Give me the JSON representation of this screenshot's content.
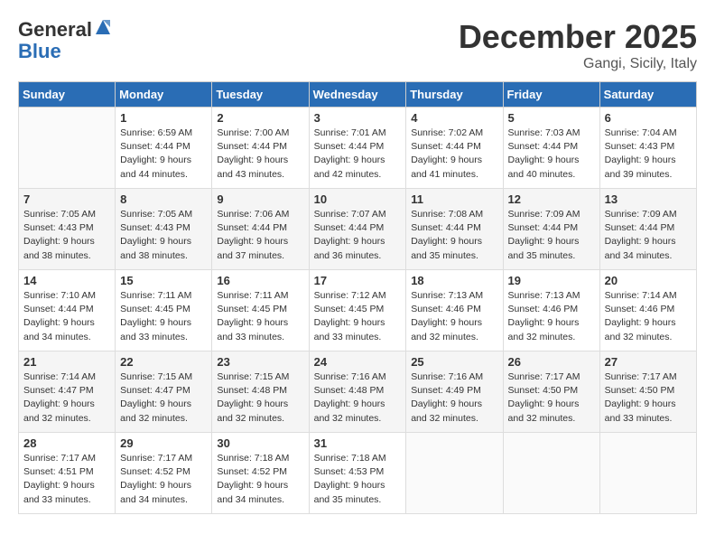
{
  "header": {
    "logo_general": "General",
    "logo_blue": "Blue",
    "month_title": "December 2025",
    "location": "Gangi, Sicily, Italy"
  },
  "weekdays": [
    "Sunday",
    "Monday",
    "Tuesday",
    "Wednesday",
    "Thursday",
    "Friday",
    "Saturday"
  ],
  "weeks": [
    [
      {
        "day": "",
        "sunrise": "",
        "sunset": "",
        "daylight": ""
      },
      {
        "day": "1",
        "sunrise": "Sunrise: 6:59 AM",
        "sunset": "Sunset: 4:44 PM",
        "daylight": "Daylight: 9 hours and 44 minutes."
      },
      {
        "day": "2",
        "sunrise": "Sunrise: 7:00 AM",
        "sunset": "Sunset: 4:44 PM",
        "daylight": "Daylight: 9 hours and 43 minutes."
      },
      {
        "day": "3",
        "sunrise": "Sunrise: 7:01 AM",
        "sunset": "Sunset: 4:44 PM",
        "daylight": "Daylight: 9 hours and 42 minutes."
      },
      {
        "day": "4",
        "sunrise": "Sunrise: 7:02 AM",
        "sunset": "Sunset: 4:44 PM",
        "daylight": "Daylight: 9 hours and 41 minutes."
      },
      {
        "day": "5",
        "sunrise": "Sunrise: 7:03 AM",
        "sunset": "Sunset: 4:44 PM",
        "daylight": "Daylight: 9 hours and 40 minutes."
      },
      {
        "day": "6",
        "sunrise": "Sunrise: 7:04 AM",
        "sunset": "Sunset: 4:43 PM",
        "daylight": "Daylight: 9 hours and 39 minutes."
      }
    ],
    [
      {
        "day": "7",
        "sunrise": "Sunrise: 7:05 AM",
        "sunset": "Sunset: 4:43 PM",
        "daylight": "Daylight: 9 hours and 38 minutes."
      },
      {
        "day": "8",
        "sunrise": "Sunrise: 7:05 AM",
        "sunset": "Sunset: 4:43 PM",
        "daylight": "Daylight: 9 hours and 38 minutes."
      },
      {
        "day": "9",
        "sunrise": "Sunrise: 7:06 AM",
        "sunset": "Sunset: 4:44 PM",
        "daylight": "Daylight: 9 hours and 37 minutes."
      },
      {
        "day": "10",
        "sunrise": "Sunrise: 7:07 AM",
        "sunset": "Sunset: 4:44 PM",
        "daylight": "Daylight: 9 hours and 36 minutes."
      },
      {
        "day": "11",
        "sunrise": "Sunrise: 7:08 AM",
        "sunset": "Sunset: 4:44 PM",
        "daylight": "Daylight: 9 hours and 35 minutes."
      },
      {
        "day": "12",
        "sunrise": "Sunrise: 7:09 AM",
        "sunset": "Sunset: 4:44 PM",
        "daylight": "Daylight: 9 hours and 35 minutes."
      },
      {
        "day": "13",
        "sunrise": "Sunrise: 7:09 AM",
        "sunset": "Sunset: 4:44 PM",
        "daylight": "Daylight: 9 hours and 34 minutes."
      }
    ],
    [
      {
        "day": "14",
        "sunrise": "Sunrise: 7:10 AM",
        "sunset": "Sunset: 4:44 PM",
        "daylight": "Daylight: 9 hours and 34 minutes."
      },
      {
        "day": "15",
        "sunrise": "Sunrise: 7:11 AM",
        "sunset": "Sunset: 4:45 PM",
        "daylight": "Daylight: 9 hours and 33 minutes."
      },
      {
        "day": "16",
        "sunrise": "Sunrise: 7:11 AM",
        "sunset": "Sunset: 4:45 PM",
        "daylight": "Daylight: 9 hours and 33 minutes."
      },
      {
        "day": "17",
        "sunrise": "Sunrise: 7:12 AM",
        "sunset": "Sunset: 4:45 PM",
        "daylight": "Daylight: 9 hours and 33 minutes."
      },
      {
        "day": "18",
        "sunrise": "Sunrise: 7:13 AM",
        "sunset": "Sunset: 4:46 PM",
        "daylight": "Daylight: 9 hours and 32 minutes."
      },
      {
        "day": "19",
        "sunrise": "Sunrise: 7:13 AM",
        "sunset": "Sunset: 4:46 PM",
        "daylight": "Daylight: 9 hours and 32 minutes."
      },
      {
        "day": "20",
        "sunrise": "Sunrise: 7:14 AM",
        "sunset": "Sunset: 4:46 PM",
        "daylight": "Daylight: 9 hours and 32 minutes."
      }
    ],
    [
      {
        "day": "21",
        "sunrise": "Sunrise: 7:14 AM",
        "sunset": "Sunset: 4:47 PM",
        "daylight": "Daylight: 9 hours and 32 minutes."
      },
      {
        "day": "22",
        "sunrise": "Sunrise: 7:15 AM",
        "sunset": "Sunset: 4:47 PM",
        "daylight": "Daylight: 9 hours and 32 minutes."
      },
      {
        "day": "23",
        "sunrise": "Sunrise: 7:15 AM",
        "sunset": "Sunset: 4:48 PM",
        "daylight": "Daylight: 9 hours and 32 minutes."
      },
      {
        "day": "24",
        "sunrise": "Sunrise: 7:16 AM",
        "sunset": "Sunset: 4:48 PM",
        "daylight": "Daylight: 9 hours and 32 minutes."
      },
      {
        "day": "25",
        "sunrise": "Sunrise: 7:16 AM",
        "sunset": "Sunset: 4:49 PM",
        "daylight": "Daylight: 9 hours and 32 minutes."
      },
      {
        "day": "26",
        "sunrise": "Sunrise: 7:17 AM",
        "sunset": "Sunset: 4:50 PM",
        "daylight": "Daylight: 9 hours and 32 minutes."
      },
      {
        "day": "27",
        "sunrise": "Sunrise: 7:17 AM",
        "sunset": "Sunset: 4:50 PM",
        "daylight": "Daylight: 9 hours and 33 minutes."
      }
    ],
    [
      {
        "day": "28",
        "sunrise": "Sunrise: 7:17 AM",
        "sunset": "Sunset: 4:51 PM",
        "daylight": "Daylight: 9 hours and 33 minutes."
      },
      {
        "day": "29",
        "sunrise": "Sunrise: 7:17 AM",
        "sunset": "Sunset: 4:52 PM",
        "daylight": "Daylight: 9 hours and 34 minutes."
      },
      {
        "day": "30",
        "sunrise": "Sunrise: 7:18 AM",
        "sunset": "Sunset: 4:52 PM",
        "daylight": "Daylight: 9 hours and 34 minutes."
      },
      {
        "day": "31",
        "sunrise": "Sunrise: 7:18 AM",
        "sunset": "Sunset: 4:53 PM",
        "daylight": "Daylight: 9 hours and 35 minutes."
      },
      {
        "day": "",
        "sunrise": "",
        "sunset": "",
        "daylight": ""
      },
      {
        "day": "",
        "sunrise": "",
        "sunset": "",
        "daylight": ""
      },
      {
        "day": "",
        "sunrise": "",
        "sunset": "",
        "daylight": ""
      }
    ]
  ]
}
